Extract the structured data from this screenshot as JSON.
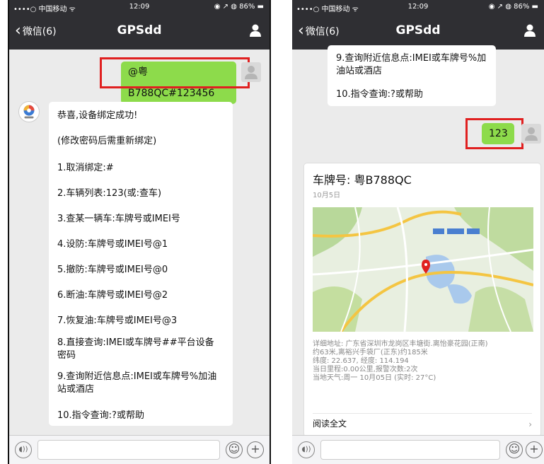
{
  "status": {
    "carrier": "••••○ 中国移动 ᯤ",
    "time": "12:09",
    "right": "◉ ↗ ◍ 86% ▬"
  },
  "nav": {
    "back_label": "微信(6)",
    "title": "GPSdd"
  },
  "left_screen": {
    "sent_message": "@粤B788QC#123456",
    "reply_lines": [
      "恭喜,设备绑定成功!",
      "(修改密码后需重新绑定)",
      "1.取消绑定:#",
      "2.车辆列表:123(或:查车)",
      "3.查某一辆车:车牌号或IMEI号",
      "4.设防:车牌号或IMEI号@1",
      "5.撤防:车牌号或IMEI号@0",
      "6.断油:车牌号或IMEI号@2",
      "7.恢复油:车牌号或IMEI号@3",
      "8.直接查询:IMEI或车牌号##平台设备密码",
      "9.查询附近信息点:IMEI或车牌号%加油站或酒店",
      "10.指令查询:?或帮助"
    ]
  },
  "right_screen": {
    "top_reply_lines": [
      "9.查询附近信息点:IMEI或车牌号%加油站或酒店",
      "10.指令查询:?或帮助"
    ],
    "sent_message": "123",
    "card": {
      "plate": "车牌号: 粤B788QC",
      "date": "10月5日",
      "details": [
        "详细地址: 广东省深圳市龙岗区丰塘街.离怡豪花园(正南)",
        "约63米,离裕兴手袋厂(正东)约185米",
        "纬度: 22.637, 经度: 114.194",
        "当日里程:0.00公里,报警次数:2次",
        "当地天气:周一 10月05日 (实时: 27°C)"
      ],
      "read_all": "阅读全文",
      "arrow": "›"
    }
  },
  "input": {
    "voice_icon": "voice-icon",
    "emoji_icon": "emoji-icon",
    "plus_icon": "plus-icon"
  },
  "colors": {
    "bar": "#2f2f33",
    "chat_bg": "#ebebeb",
    "green_bubble": "#8ddb4b",
    "highlight": "#e02020"
  }
}
